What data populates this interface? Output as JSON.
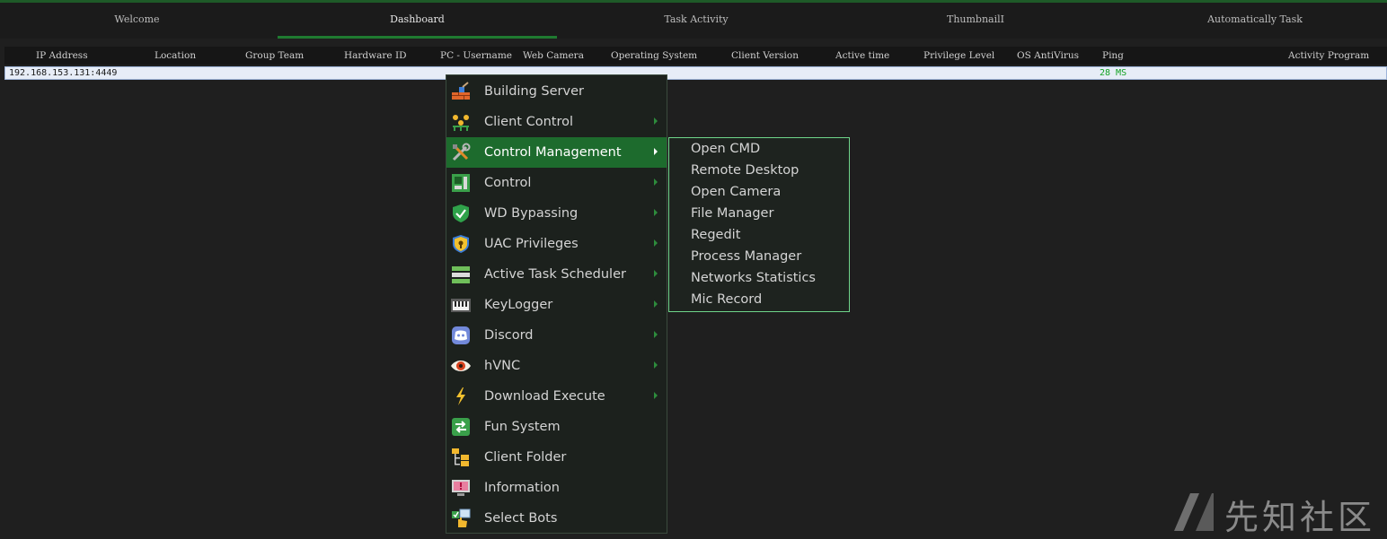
{
  "tabs": [
    "Welcome",
    "Dashboard",
    "Task Activity",
    "ThumbnailI",
    "Automatically Task"
  ],
  "active_tab": "Dashboard",
  "columns": [
    "IP Address",
    "Location",
    "Group Team",
    "Hardware ID",
    "PC - Username",
    "Web Camera",
    "Operating System",
    "Client Version",
    "Active time",
    "Privilege Level",
    "OS AntiVirus",
    "Ping",
    "Activity Program"
  ],
  "rows": [
    {
      "ip": "192.168.153.131:4449",
      "ping": "28 MS"
    }
  ],
  "context_menu": {
    "items": [
      {
        "label": "Building Server",
        "icon": "building-server-icon",
        "submenu": false
      },
      {
        "label": "Client Control",
        "icon": "client-control-icon",
        "submenu": true
      },
      {
        "label": "Control Management",
        "icon": "tools-icon",
        "submenu": true,
        "selected": true
      },
      {
        "label": "Control",
        "icon": "motherboard-icon",
        "submenu": true
      },
      {
        "label": "WD Bypassing",
        "icon": "shield-check-icon",
        "submenu": true
      },
      {
        "label": "UAC Privileges",
        "icon": "shield-lock-icon",
        "submenu": true
      },
      {
        "label": "Active Task Scheduler",
        "icon": "task-list-icon",
        "submenu": true
      },
      {
        "label": "KeyLogger",
        "icon": "keyboard-icon",
        "submenu": true
      },
      {
        "label": "Discord",
        "icon": "discord-icon",
        "submenu": true
      },
      {
        "label": "hVNC",
        "icon": "eye-icon",
        "submenu": true
      },
      {
        "label": "Download Execute",
        "icon": "lightning-icon",
        "submenu": true
      },
      {
        "label": "Fun System",
        "icon": "fun-system-icon",
        "submenu": false
      },
      {
        "label": "Client Folder",
        "icon": "folder-tree-icon",
        "submenu": false
      },
      {
        "label": "Information",
        "icon": "info-monitor-icon",
        "submenu": false
      },
      {
        "label": "Select Bots",
        "icon": "select-hand-icon",
        "submenu": false
      }
    ]
  },
  "submenu": {
    "items": [
      "Open CMD",
      "Remote Desktop",
      "Open Camera",
      "File Manager",
      "Regedit",
      "Process Manager",
      "Networks Statistics",
      "Mic Record"
    ]
  },
  "watermark": {
    "text": "先知社区"
  },
  "colors": {
    "accent": "#1d6b2d",
    "submenu_border": "#6fd58a",
    "ping": "#14a324"
  }
}
